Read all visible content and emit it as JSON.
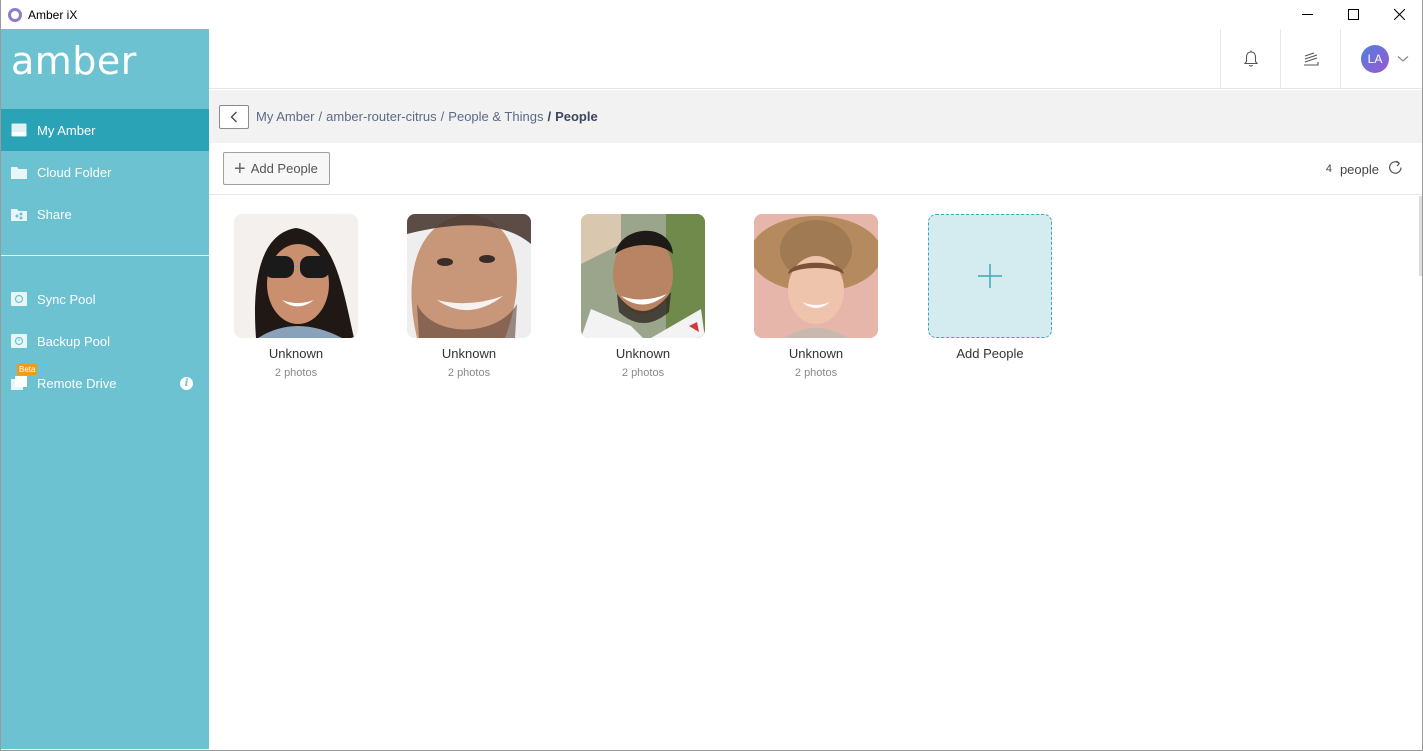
{
  "window": {
    "title": "Amber iX"
  },
  "sidebar": {
    "logo": "amber",
    "items": [
      {
        "label": "My Amber",
        "icon": "drive-icon",
        "active": true
      },
      {
        "label": "Cloud Folder",
        "icon": "folder-icon"
      },
      {
        "label": "Share",
        "icon": "share-icon"
      },
      {
        "label": "Sync Pool",
        "icon": "sync-icon"
      },
      {
        "label": "Backup Pool",
        "icon": "backup-icon"
      },
      {
        "label": "Remote Drive",
        "icon": "remote-drive-icon",
        "badge": "Beta"
      }
    ]
  },
  "header": {
    "avatar_initials": "LA"
  },
  "breadcrumb": {
    "items": [
      "My Amber",
      "amber-router-citrus",
      "People & Things"
    ],
    "current": "People"
  },
  "toolbar": {
    "add_label": "Add People",
    "count": "4",
    "count_label": "people"
  },
  "people": [
    {
      "name": "Unknown",
      "photos": "2 photos"
    },
    {
      "name": "Unknown",
      "photos": "2 photos"
    },
    {
      "name": "Unknown",
      "photos": "2 photos"
    },
    {
      "name": "Unknown",
      "photos": "2 photos"
    }
  ],
  "add_tile": {
    "label": "Add People"
  },
  "colors": {
    "sidebar": "#6cc2d0",
    "active": "#2aa3b6",
    "accent": "#3fa7b8"
  }
}
